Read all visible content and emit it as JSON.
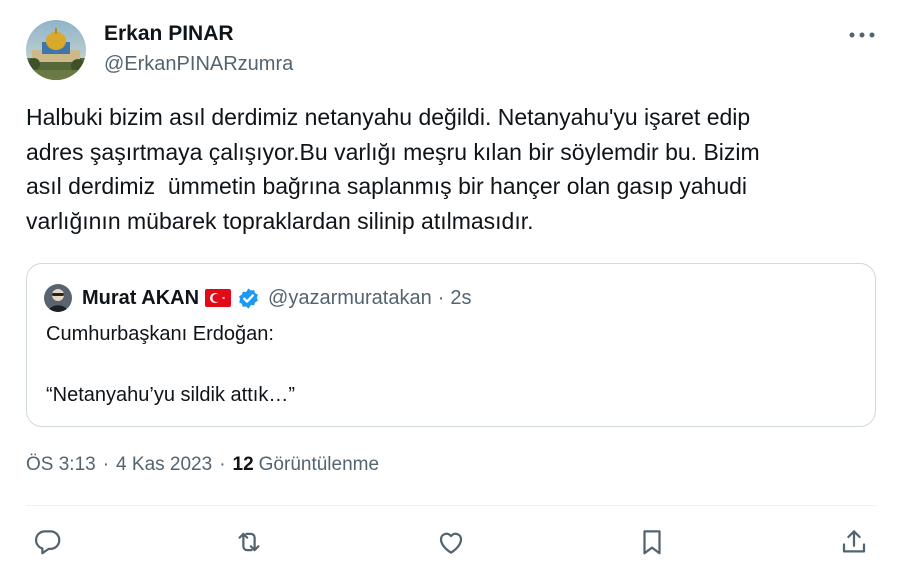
{
  "author": {
    "name": "Erkan PINAR",
    "handle": "@ErkanPINARzumra",
    "avatar_icon": "dome-of-the-rock-avatar"
  },
  "more_icon": "more-horizontal-icon",
  "tweet": {
    "lines": [
      "Halbuki bizim asıl derdimiz netanyahu değildi. Netanyahu'yu işaret edip",
      "adres şaşırtmaya çalışıyor.Bu varlığı meşru kılan bir söylemdir bu. Bizim",
      "asıl derdimiz  ümmetin bağrına saplanmış bir hançer olan gasıp yahudi",
      "varlığının mübarek topraklardan silinip atılmasıdır."
    ]
  },
  "quote": {
    "name": "Murat AKAN",
    "flag_icon": "turkey-flag-icon",
    "verified_icon": "verified-badge-icon",
    "handle": "@yazarmuratakan",
    "separator": "·",
    "time": "2s",
    "line1": "Cumhurbaşkanı Erdoğan:",
    "line2": "“Netanyahu’yu sildik attık…”"
  },
  "meta": {
    "time": "ÖS 3:13",
    "dot1": "·",
    "date": "4 Kas 2023",
    "dot2": "·",
    "views_count": "12",
    "views_label": "Görüntülenme"
  },
  "actions": [
    "reply-icon",
    "retweet-icon",
    "like-icon",
    "bookmark-icon",
    "share-icon"
  ],
  "colors": {
    "text": "#0f1419",
    "secondary": "#536471",
    "border": "#cfd9de",
    "verified": "#1d9bf0",
    "flag_red": "#e30a17"
  }
}
